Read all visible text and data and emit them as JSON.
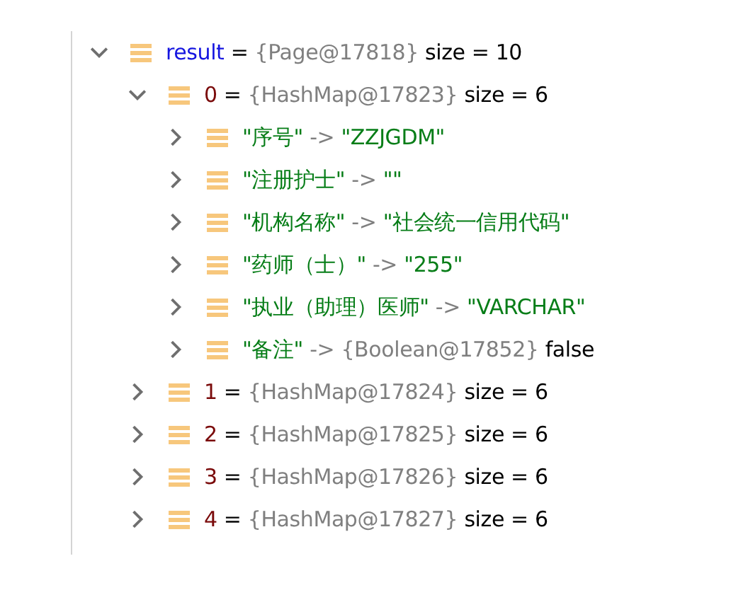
{
  "variables": [
    {
      "label": "result",
      "kind": "variable",
      "separator": "=",
      "object_ref": "{Page@17818}",
      "detail": "size = 10",
      "expanded": true,
      "children": [
        {
          "label": "0",
          "kind": "index",
          "separator": "=",
          "object_ref": "{HashMap@17823}",
          "detail": "size = 6",
          "expanded": true,
          "children": [
            {
              "label": "\"序号\"",
              "kind": "string",
              "separator": "->",
              "string_value": "\"ZZJGDM\"",
              "expanded": false
            },
            {
              "label": "\"注册护士\"",
              "kind": "string",
              "separator": "->",
              "string_value": "\"\"",
              "expanded": false
            },
            {
              "label": "\"机构名称\"",
              "kind": "string",
              "separator": "->",
              "string_value": "\"社会统一信用代码\"",
              "expanded": false
            },
            {
              "label": "\"药师（士）\"",
              "kind": "string",
              "separator": "->",
              "string_value": "\"255\"",
              "expanded": false
            },
            {
              "label": "\"执业（助理）医师\"",
              "kind": "string",
              "separator": "->",
              "string_value": "\"VARCHAR\"",
              "expanded": false
            },
            {
              "label": "\"备注\"",
              "kind": "string",
              "separator": "->",
              "object_ref": "{Boolean@17852}",
              "detail": "false",
              "expanded": false
            }
          ]
        },
        {
          "label": "1",
          "kind": "index",
          "separator": "=",
          "object_ref": "{HashMap@17824}",
          "detail": "size = 6",
          "expanded": false
        },
        {
          "label": "2",
          "kind": "index",
          "separator": "=",
          "object_ref": "{HashMap@17825}",
          "detail": "size = 6",
          "expanded": false
        },
        {
          "label": "3",
          "kind": "index",
          "separator": "=",
          "object_ref": "{HashMap@17826}",
          "detail": "size = 6",
          "expanded": false
        },
        {
          "label": "4",
          "kind": "index",
          "separator": "=",
          "object_ref": "{HashMap@17827}",
          "detail": "size = 6",
          "expanded": false
        }
      ]
    }
  ]
}
